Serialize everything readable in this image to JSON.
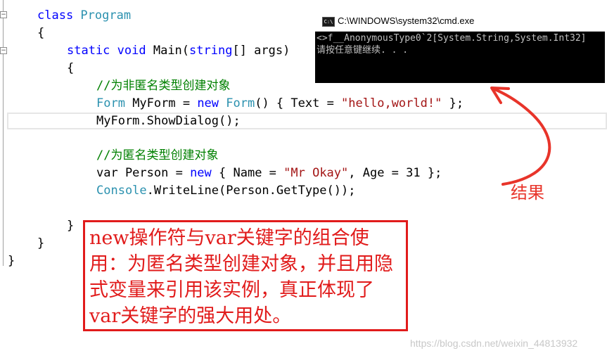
{
  "editor": {
    "lines": [
      {
        "id": "line-class",
        "tokens": [
          {
            "t": "class ",
            "c": "kw"
          },
          {
            "t": "Program",
            "c": "type"
          }
        ]
      },
      {
        "id": "line-open-class",
        "tokens": [
          {
            "t": "{",
            "c": ""
          }
        ]
      },
      {
        "id": "line-main",
        "tokens": [
          {
            "t": "static ",
            "c": "kw"
          },
          {
            "t": "void ",
            "c": "kw"
          },
          {
            "t": "Main(",
            "c": ""
          },
          {
            "t": "string",
            "c": "kw"
          },
          {
            "t": "[] args)",
            "c": ""
          }
        ]
      },
      {
        "id": "line-open-main",
        "tokens": [
          {
            "t": "{",
            "c": ""
          }
        ]
      },
      {
        "id": "line-comment-1",
        "tokens": [
          {
            "t": "//为非匿名类型创建对象",
            "c": "cm"
          }
        ]
      },
      {
        "id": "line-form",
        "tokens": [
          {
            "t": "Form",
            "c": "type"
          },
          {
            "t": " MyForm = ",
            "c": ""
          },
          {
            "t": "new ",
            "c": "kw"
          },
          {
            "t": "Form",
            "c": "type"
          },
          {
            "t": "() { Text = ",
            "c": ""
          },
          {
            "t": "\"hello,world!\"",
            "c": "str"
          },
          {
            "t": " };",
            "c": ""
          }
        ]
      },
      {
        "id": "line-showdialog",
        "tokens": [
          {
            "t": "MyForm.ShowDialog();",
            "c": ""
          }
        ]
      },
      {
        "id": "line-comment-2",
        "tokens": [
          {
            "t": "//为匿名类型创建对象",
            "c": "cm"
          }
        ]
      },
      {
        "id": "line-var",
        "tokens": [
          {
            "t": "var Person = ",
            "c": ""
          },
          {
            "t": "new",
            "c": "kw"
          },
          {
            "t": " { Name = ",
            "c": ""
          },
          {
            "t": "\"Mr Okay\"",
            "c": "str"
          },
          {
            "t": ", Age = 31 };",
            "c": ""
          }
        ]
      },
      {
        "id": "line-writeline",
        "tokens": [
          {
            "t": "Console",
            "c": "type"
          },
          {
            "t": ".WriteLine(Person.GetType());",
            "c": ""
          }
        ]
      },
      {
        "id": "line-close-main",
        "tokens": [
          {
            "t": "}",
            "c": ""
          }
        ]
      },
      {
        "id": "line-close-class",
        "tokens": [
          {
            "t": "}",
            "c": ""
          }
        ]
      },
      {
        "id": "line-close-ns",
        "tokens": [
          {
            "t": "}",
            "c": ""
          }
        ]
      }
    ]
  },
  "console": {
    "title": "C:\\WINDOWS\\system32\\cmd.exe",
    "icon": "cmd-icon",
    "icon_text": "C:\\",
    "output": [
      "<>f__AnonymousType0`2[System.String,System.Int32]",
      "请按任意键继续. . ."
    ]
  },
  "annotations": {
    "result_label": "结果",
    "note": "new操作符与var关键字的组合使用：为匿名类型创建对象，并且用隐式变量来引用该实例，真正体现了var关键字的强大用处。",
    "arrow_color": "#e8342a",
    "box_color": "#e11b1b"
  },
  "watermark": "https://blog.csdn.net/weixin_44813932"
}
